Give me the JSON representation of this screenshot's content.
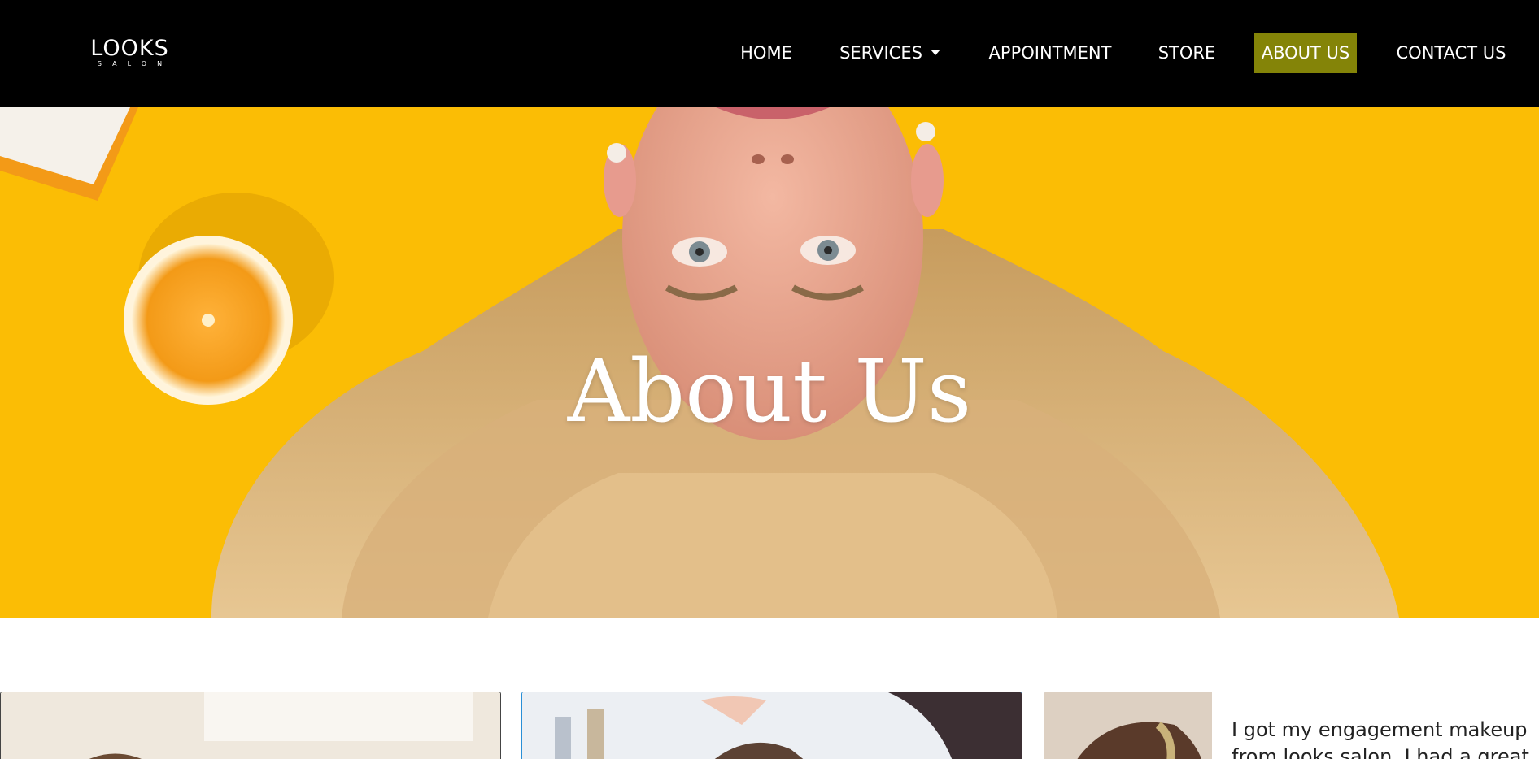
{
  "brand": {
    "name": "LOOKS",
    "tagline": "SALON"
  },
  "nav": {
    "items": [
      {
        "label": "HOME",
        "active": false
      },
      {
        "label": "SERVICES",
        "active": false,
        "dropdown": true
      },
      {
        "label": "APPOINTMENT",
        "active": false
      },
      {
        "label": "STORE",
        "active": false
      },
      {
        "label": "ABOUT US",
        "active": true
      },
      {
        "label": "CONTACT US",
        "active": false
      }
    ]
  },
  "hero": {
    "title": "About Us"
  },
  "testimonials": [
    {
      "text": ""
    },
    {
      "text": ""
    },
    {
      "text": "I got my engagement makeup from looks salon. I had a great"
    }
  ],
  "colors": {
    "navbar_bg": "#000000",
    "active_nav_bg": "#848408",
    "hero_bg": "#fbbd05",
    "hero_title": "#ffffff",
    "card2_border": "#2a8fd6"
  },
  "icons": {
    "services_dropdown": "chevron-down-icon"
  }
}
